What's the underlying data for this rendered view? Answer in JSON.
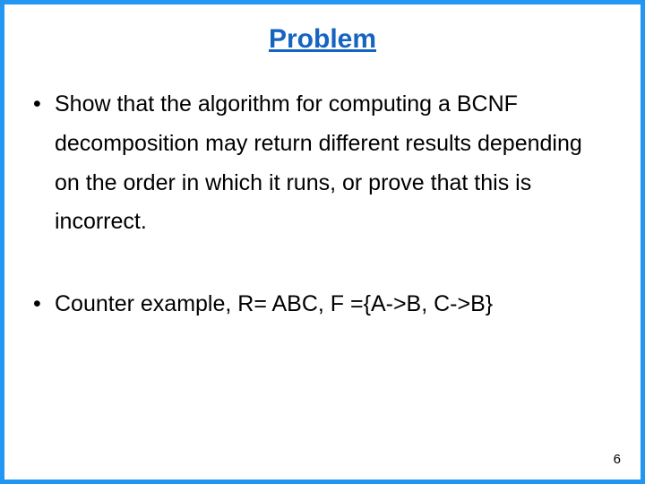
{
  "title": "Problem",
  "bullets": [
    "Show that the algorithm for computing a BCNF decomposition may return different results depending on the order in which it runs, or prove that this is incorrect.",
    "Counter example, R= ABC, F ={A->B, C->B}"
  ],
  "page_number": "6"
}
